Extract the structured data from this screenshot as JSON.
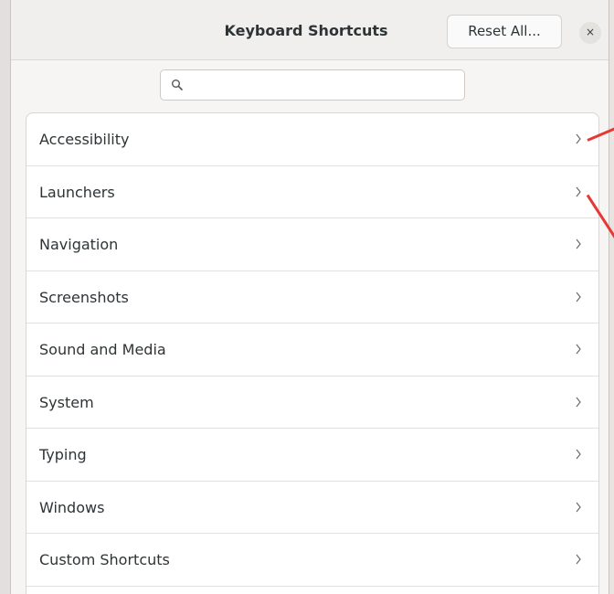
{
  "window": {
    "title": "Keyboard Shortcuts",
    "reset_label": "Reset All...",
    "close_label": "×"
  },
  "search": {
    "placeholder": "",
    "value": ""
  },
  "categories": [
    {
      "label": "Accessibility"
    },
    {
      "label": "Launchers"
    },
    {
      "label": "Navigation"
    },
    {
      "label": "Screenshots"
    },
    {
      "label": "Sound and Media"
    },
    {
      "label": "System"
    },
    {
      "label": "Typing"
    },
    {
      "label": "Windows"
    },
    {
      "label": "Custom Shortcuts"
    }
  ],
  "icons": {
    "search": "search-icon",
    "row_arrow": "chevron-right-icon",
    "close": "close-icon"
  },
  "colors": {
    "annotation": "#e53935",
    "window_bg": "#f6f5f4",
    "list_bg": "#ffffff"
  }
}
